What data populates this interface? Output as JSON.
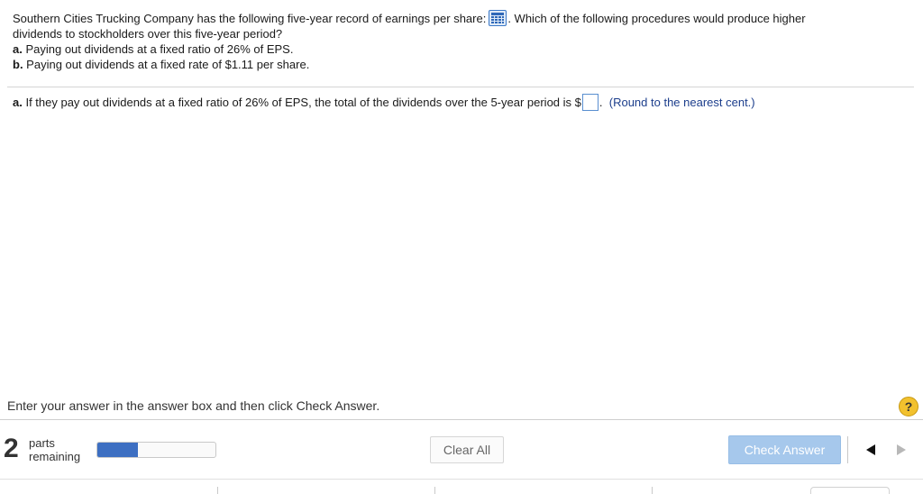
{
  "question": {
    "intro": "Southern Cities Trucking Company has the following five-year record of earnings per share:",
    "after_icon": ". Which of the following procedures would produce higher",
    "line2": "dividends to stockholders over this five-year period?",
    "option_a_label": "a.",
    "option_a_text": " Paying out dividends at a fixed ratio of 26% of EPS.",
    "option_b_label": "b.",
    "option_b_text": " Paying out dividends at a fixed rate of $1.11 per share.",
    "data_icon": "table-grid-icon"
  },
  "part_a": {
    "label": "a.",
    "text_before": " If they pay out dividends at a fixed ratio of 26% of EPS, the total of the dividends over the 5-year period is $",
    "answer_value": "",
    "text_after": ".",
    "hint": "(Round to the nearest cent.)"
  },
  "instruction": "Enter your answer in the answer box and then click Check Answer.",
  "help_label": "?",
  "status": {
    "parts_count": "2",
    "parts_label_1": "parts",
    "parts_label_2": "remaining",
    "progress_fraction": 0.34
  },
  "buttons": {
    "clear_all": "Clear All",
    "check_answer": "Check Answer"
  },
  "colors": {
    "accent_blue": "#3d6fc2",
    "check_button_bg": "#a6c8ec",
    "hint_text": "#1c3e8c",
    "help_icon_bg": "#f2c12e"
  }
}
